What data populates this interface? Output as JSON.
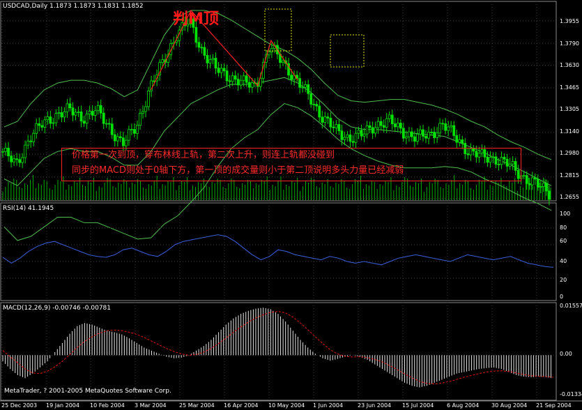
{
  "main": {
    "symbol_label": "USDCAD,Daily  1.1873 1.1873 1.1831 1.1852",
    "title_annotation": "判M顶",
    "annotation_lines": [
      "价格第一次到顶，穿布林线上轨，第二次上升，则连上轨都没碰到",
      "同步的MACD则处于0轴下方，第一顶的成交量则小于第二顶说明多头力量已经减弱"
    ],
    "price_ticks": [
      "1.3955",
      "1.3790",
      "1.3630",
      "1.3465",
      "1.3305",
      "1.3140",
      "1.2980",
      "1.2815",
      "1.2655"
    ]
  },
  "rsi": {
    "label": "RSI(14) 41.1945",
    "ticks": [
      "100",
      "80",
      "60",
      "40",
      "20",
      "0"
    ]
  },
  "macd": {
    "label": "MACD(12,26,9) -0.00746 -0.00781",
    "ticks": [
      "0.01557",
      "0.00",
      "-0.01334"
    ]
  },
  "footer": {
    "copyright": "MetaTrader, ? 2001-2005 MetaQuotes Software Corp.",
    "dates": [
      "25 Dec 2003",
      "19 Jan 2004",
      "10 Feb 2004",
      "3 Mar 2004",
      "25 Mar 2004",
      "16 Apr 2004",
      "10 May 2004",
      "1 Jun 2004",
      "23 Jun 2004",
      "15 Jul 2004",
      "6 Aug 2004",
      "30 Aug 2004",
      "21 Sep 2004"
    ]
  },
  "colors": {
    "background": "#000000",
    "candle": "#00e000",
    "bollinger": "#4fbf4f",
    "volume": "#00b000",
    "grid": "#3a3a3a",
    "rsi": "#3a5fdc",
    "macd_hist": "#e6e6e6",
    "macd_signal": "#e01010",
    "annotation": "#ff2020",
    "marker_box": "#e6e600"
  },
  "chart_data": [
    {
      "type": "line",
      "title": "USDCAD,Daily",
      "ylim": [
        1.2655,
        1.4035
      ],
      "ticks": [
        1.3955,
        1.379,
        1.363,
        1.3465,
        1.3305,
        1.314,
        1.298,
        1.2815,
        1.2655
      ],
      "x": [
        "25 Dec 2003",
        "19 Jan 2004",
        "10 Feb 2004",
        "3 Mar 2004",
        "25 Mar 2004",
        "16 Apr 2004",
        "10 May 2004",
        "1 Jun 2004",
        "23 Jun 2004",
        "15 Jul 2004",
        "6 Aug 2004",
        "30 Aug 2004",
        "21 Sep 2004"
      ],
      "series": [
        {
          "values": [
            1.3,
            1.29,
            1.31,
            1.32,
            1.327,
            1.33,
            1.325,
            1.33,
            1.318,
            1.305,
            1.318,
            1.345,
            1.365,
            1.385,
            1.395,
            1.373,
            1.36,
            1.355,
            1.35,
            1.348,
            1.376,
            1.366,
            1.352,
            1.34,
            1.325,
            1.315,
            1.31,
            1.312,
            1.32,
            1.322,
            1.315,
            1.31,
            1.312,
            1.32,
            1.31,
            1.3,
            1.296,
            1.295,
            1.29,
            1.282,
            1.276,
            1.27
          ]
        },
        {
          "values": [
            1.318,
            1.322,
            1.335,
            1.345,
            1.35,
            1.352,
            1.352,
            1.35,
            1.346,
            1.34,
            1.345,
            1.365,
            1.385,
            1.398,
            1.403,
            1.403,
            1.401,
            1.396,
            1.39,
            1.384,
            1.378,
            1.374,
            1.368,
            1.36,
            1.35,
            1.341,
            1.337,
            1.336,
            1.337,
            1.338,
            1.338,
            1.336,
            1.334,
            1.331,
            1.327,
            1.322,
            1.318,
            1.312,
            1.307,
            1.303,
            1.298,
            1.294
          ]
        },
        {
          "values": [
            1.28,
            1.275,
            1.285,
            1.295,
            1.3,
            1.302,
            1.3,
            1.3,
            1.296,
            1.29,
            1.29,
            1.3,
            1.315,
            1.325,
            1.335,
            1.34,
            1.345,
            1.349,
            1.349,
            1.35,
            1.352,
            1.354,
            1.35,
            1.343,
            1.334,
            1.324,
            1.318,
            1.316,
            1.316,
            1.315,
            1.314,
            1.313,
            1.312,
            1.311,
            1.307,
            1.303,
            1.299,
            1.294,
            1.29,
            1.285,
            1.28,
            1.275
          ]
        },
        {
          "values": [
            1.245,
            1.235,
            1.238,
            1.245,
            1.252,
            1.252,
            1.248,
            1.248,
            1.244,
            1.24,
            1.236,
            1.237,
            1.247,
            1.253,
            1.263,
            1.274,
            1.289,
            1.302,
            1.31,
            1.316,
            1.327,
            1.335,
            1.332,
            1.326,
            1.318,
            1.309,
            1.302,
            1.297,
            1.293,
            1.29,
            1.288,
            1.288,
            1.288,
            1.289,
            1.288,
            1.285,
            1.28,
            1.276,
            1.271,
            1.266,
            1.262,
            1.257
          ]
        }
      ]
    },
    {
      "type": "line",
      "title": "RSI(14)",
      "ylim": [
        0,
        100
      ],
      "ticks": [
        100,
        80,
        60,
        40,
        20,
        0
      ],
      "series": [
        {
          "values": [
            45,
            38,
            44,
            52,
            58,
            62,
            64,
            60,
            56,
            52,
            48,
            46,
            45,
            48,
            54,
            56,
            52,
            48,
            46,
            52,
            60,
            64,
            66,
            68,
            70,
            72,
            70,
            64,
            56,
            48,
            42,
            46,
            54,
            52,
            48,
            46,
            44,
            42,
            46,
            44,
            40,
            38,
            40,
            38,
            36,
            40,
            44,
            46,
            48,
            46,
            44,
            42,
            40,
            44,
            48,
            46,
            44,
            42,
            44,
            46,
            42,
            38,
            36,
            34,
            33
          ]
        }
      ]
    },
    {
      "type": "bar",
      "title": "MACD(12,26,9)",
      "ylim": [
        -0.01334,
        0.01557
      ],
      "ticks": [
        0.01557,
        0.0,
        -0.01334
      ],
      "series": [
        {
          "values": [
            -0.002,
            -0.0045,
            -0.0065,
            -0.0075,
            -0.006,
            -0.004,
            -0.002,
            0.001,
            0.004,
            0.007,
            0.0095,
            0.0105,
            0.01,
            0.009,
            0.008,
            0.0075,
            0.0068,
            0.0055,
            0.004,
            0.0025,
            0.0015,
            0.0005,
            -0.0005,
            -0.001,
            -0.0008,
            0.0,
            0.0015,
            0.003,
            0.005,
            0.0075,
            0.01,
            0.012,
            0.0135,
            0.0145,
            0.0152,
            0.0155,
            0.015,
            0.0135,
            0.011,
            0.008,
            0.005,
            0.0025,
            0.0005,
            -0.001,
            -0.0018,
            -0.0012,
            -0.0005,
            0.0,
            -0.0005,
            -0.0015,
            -0.003,
            -0.0045,
            -0.006,
            -0.0075,
            -0.009,
            -0.01,
            -0.0105,
            -0.01,
            -0.009,
            -0.008,
            -0.007,
            -0.006,
            -0.0055,
            -0.005,
            -0.0045,
            -0.0042,
            -0.004,
            -0.0045,
            -0.0055,
            -0.0065,
            -0.007,
            -0.0072,
            -0.007,
            -0.0072,
            -0.0075
          ]
        },
        {
          "values": [
            0.0015,
            -0.0005,
            -0.0025,
            -0.0045,
            -0.0058,
            -0.006,
            -0.0052,
            -0.0038,
            -0.002,
            0.0002,
            0.0025,
            0.0045,
            0.006,
            0.0072,
            0.008,
            0.0082,
            0.008,
            0.0075,
            0.0068,
            0.0058,
            0.0046,
            0.0034,
            0.0022,
            0.0012,
            0.0004,
            0.0,
            0.0002,
            0.001,
            0.0022,
            0.0038,
            0.0056,
            0.0075,
            0.0092,
            0.0108,
            0.0121,
            0.0132,
            0.014,
            0.0143,
            0.0138,
            0.0124,
            0.0105,
            0.0083,
            0.006,
            0.0038,
            0.0018,
            0.0004,
            -0.0004,
            -0.0006,
            -0.0005,
            -0.0008,
            -0.0014,
            -0.0022,
            -0.0034,
            -0.0047,
            -0.0061,
            -0.0074,
            -0.0085,
            -0.0092,
            -0.0094,
            -0.0091,
            -0.0086,
            -0.0079,
            -0.0072,
            -0.0066,
            -0.006,
            -0.0055,
            -0.0052,
            -0.0051,
            -0.0053,
            -0.0058,
            -0.0063,
            -0.0067,
            -0.0069,
            -0.007,
            -0.0072
          ]
        }
      ]
    }
  ]
}
